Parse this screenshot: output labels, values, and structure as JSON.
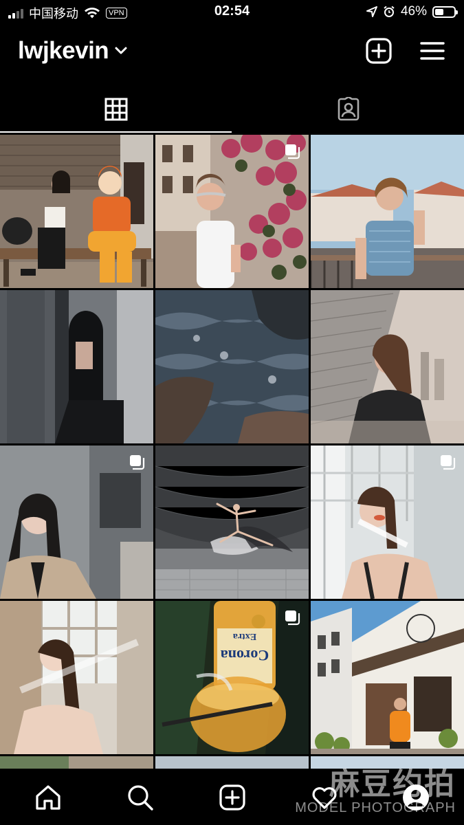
{
  "status_bar": {
    "carrier": "中国移动",
    "vpn": "VPN",
    "time": "02:54",
    "battery": "46%",
    "battery_level": 0.46
  },
  "header": {
    "username": "lwjkevin",
    "icons": [
      "chevron-down-icon",
      "add-post-icon",
      "menu-icon"
    ]
  },
  "tabs": [
    {
      "icon": "grid-icon",
      "active": true
    },
    {
      "icon": "tagged-icon",
      "active": false
    }
  ],
  "grid": {
    "posts": [
      {
        "scene": "street-bench",
        "multi": false
      },
      {
        "scene": "flowers-portrait",
        "multi": true
      },
      {
        "scene": "rooftop-denim",
        "multi": false
      },
      {
        "scene": "dark-door",
        "multi": false
      },
      {
        "scene": "rocks-water",
        "multi": false
      },
      {
        "scene": "metal-panel",
        "multi": false
      },
      {
        "scene": "trench-coat",
        "multi": true
      },
      {
        "scene": "ballet",
        "multi": false
      },
      {
        "scene": "window-light",
        "multi": true
      },
      {
        "scene": "window-portrait",
        "multi": false
      },
      {
        "scene": "beer-bottle",
        "multi": true
      },
      {
        "scene": "street-building",
        "multi": false
      }
    ]
  },
  "bottom_nav": {
    "items": [
      "home-icon",
      "search-icon",
      "new-post-icon",
      "activity-icon",
      "profile-icon"
    ]
  },
  "watermark": {
    "title": "麻豆约拍",
    "subtitle": "MODEL PHOTOGRAPH"
  }
}
